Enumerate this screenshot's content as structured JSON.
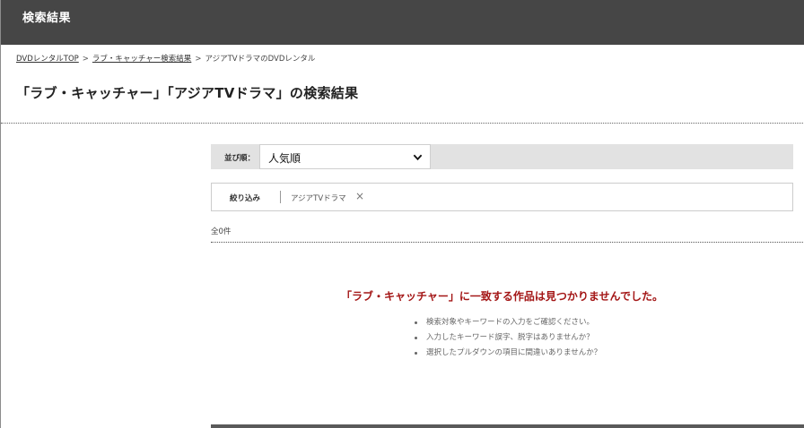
{
  "header": {
    "title": "検索結果"
  },
  "breadcrumb": {
    "items": [
      {
        "label": "DVDレンタルTOP"
      },
      {
        "label": "ラブ・キャッチャー検索結果"
      },
      {
        "label": "アジアTVドラマのDVDレンタル"
      }
    ],
    "separator": ">"
  },
  "page_title": "「ラブ・キャッチャー」「アジアTVドラマ」の検索結果",
  "sort": {
    "label": "並び順：",
    "selected": "人気順"
  },
  "filter": {
    "label": "絞り込み",
    "tag": "アジアTVドラマ",
    "remove_icon": "×"
  },
  "result_count": "全0件",
  "empty": {
    "message": "「ラブ・キャッチャー」に一致する作品は見つかりませんでした。",
    "hints": [
      "検索対象やキーワードの入力をご確認ください。",
      "入力したキーワード誤字、脱字はありませんか？",
      "選択したプルダウンの項目に間違いありませんか？"
    ]
  },
  "colors": {
    "header_bg": "#464646",
    "sort_bar_bg": "#e2e2e2",
    "empty_message": "#a31515"
  }
}
